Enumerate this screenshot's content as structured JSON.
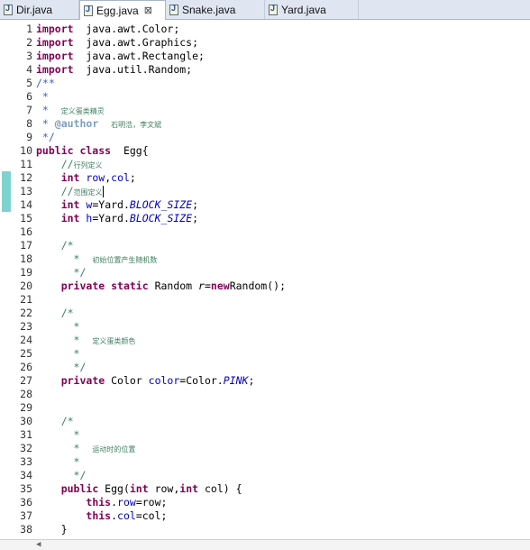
{
  "tabs": [
    {
      "label": "Dir.java",
      "active": false
    },
    {
      "label": "Egg.java",
      "active": true,
      "close": "⊠"
    },
    {
      "label": "Snake.java",
      "active": false
    },
    {
      "label": "Yard.java",
      "active": false
    }
  ],
  "editor": {
    "changed_lines": [
      12,
      13,
      14
    ],
    "lines": [
      {
        "n": "1",
        "t": [
          [
            "kw",
            "import"
          ],
          [
            "",
            "  java.awt.Color;"
          ]
        ]
      },
      {
        "n": "2",
        "t": [
          [
            "kw",
            "import"
          ],
          [
            "",
            "  java.awt.Graphics;"
          ]
        ]
      },
      {
        "n": "3",
        "t": [
          [
            "kw",
            "import"
          ],
          [
            "",
            "  java.awt.Rectangle;"
          ]
        ]
      },
      {
        "n": "4",
        "t": [
          [
            "kw",
            "import"
          ],
          [
            "",
            "  java.util.Random;"
          ]
        ]
      },
      {
        "n": "5",
        "t": [
          [
            "jd",
            "/**"
          ]
        ]
      },
      {
        "n": "6",
        "t": [
          [
            "jd",
            " *"
          ]
        ]
      },
      {
        "n": "7",
        "t": [
          [
            "jd",
            " *  "
          ],
          [
            "cjk",
            "定义蛋类精灵"
          ]
        ]
      },
      {
        "n": "8",
        "t": [
          [
            "jd",
            " * "
          ],
          [
            "tag",
            "@author"
          ],
          [
            "jd",
            "  "
          ],
          [
            "cjk",
            "石明浩，李文斌"
          ]
        ]
      },
      {
        "n": "9",
        "t": [
          [
            "jd",
            " */"
          ]
        ]
      },
      {
        "n": "10",
        "t": [
          [
            "kw",
            "public class"
          ],
          [
            "",
            "  Egg{"
          ]
        ]
      },
      {
        "n": "11",
        "t": [
          [
            "",
            "    "
          ],
          [
            "cm",
            "//"
          ],
          [
            "cjk",
            "行列定义"
          ]
        ]
      },
      {
        "n": "12",
        "t": [
          [
            "",
            "    "
          ],
          [
            "kw",
            "int"
          ],
          [
            "",
            " "
          ],
          [
            "fld",
            "row"
          ],
          [
            "",
            ","
          ],
          [
            "fld",
            "col"
          ],
          [
            "",
            ";"
          ]
        ]
      },
      {
        "n": "13",
        "t": [
          [
            "",
            "    "
          ],
          [
            "cm",
            "//"
          ],
          [
            "cjk",
            "范围定义"
          ],
          [
            "caret",
            ""
          ]
        ]
      },
      {
        "n": "14",
        "t": [
          [
            "",
            "    "
          ],
          [
            "kw",
            "int"
          ],
          [
            "",
            " "
          ],
          [
            "fld",
            "w"
          ],
          [
            "",
            "=Yard."
          ],
          [
            "st",
            "BLOCK_SIZE"
          ],
          [
            "",
            ";"
          ]
        ]
      },
      {
        "n": "15",
        "t": [
          [
            "",
            "    "
          ],
          [
            "kw",
            "int"
          ],
          [
            "",
            " "
          ],
          [
            "fld",
            "h"
          ],
          [
            "",
            "=Yard."
          ],
          [
            "st",
            "BLOCK_SIZE"
          ],
          [
            "",
            ";"
          ]
        ]
      },
      {
        "n": "16",
        "t": []
      },
      {
        "n": "17",
        "t": [
          [
            "",
            "    "
          ],
          [
            "cm",
            "/*"
          ]
        ]
      },
      {
        "n": "18",
        "t": [
          [
            "",
            "    "
          ],
          [
            "cm",
            "  *  "
          ],
          [
            "cjk",
            "初始位置产生随机数"
          ]
        ]
      },
      {
        "n": "19",
        "t": [
          [
            "",
            "    "
          ],
          [
            "cm",
            "  */"
          ]
        ]
      },
      {
        "n": "20",
        "t": [
          [
            "",
            "    "
          ],
          [
            "kw",
            "private static"
          ],
          [
            "",
            " Random "
          ],
          [
            "it",
            "r"
          ],
          [
            "",
            "="
          ],
          [
            "kw",
            "new"
          ],
          [
            "",
            "",
            " "
          ],
          [
            "",
            "Random();"
          ]
        ]
      },
      {
        "n": "21",
        "t": []
      },
      {
        "n": "22",
        "t": [
          [
            "",
            "    "
          ],
          [
            "cm",
            "/*"
          ]
        ]
      },
      {
        "n": "23",
        "t": [
          [
            "",
            "    "
          ],
          [
            "cm",
            "  *"
          ]
        ]
      },
      {
        "n": "24",
        "t": [
          [
            "",
            "    "
          ],
          [
            "cm",
            "  *  "
          ],
          [
            "cjk",
            "定义蛋类颜色"
          ]
        ]
      },
      {
        "n": "25",
        "t": [
          [
            "",
            "    "
          ],
          [
            "cm",
            "  *"
          ]
        ]
      },
      {
        "n": "26",
        "t": [
          [
            "",
            "    "
          ],
          [
            "cm",
            "  */"
          ]
        ]
      },
      {
        "n": "27",
        "t": [
          [
            "",
            "    "
          ],
          [
            "kw",
            "private"
          ],
          [
            "",
            " Color "
          ],
          [
            "fld",
            "color"
          ],
          [
            "",
            "=Color."
          ],
          [
            "st",
            "PINK"
          ],
          [
            "",
            ";"
          ]
        ]
      },
      {
        "n": "28",
        "t": []
      },
      {
        "n": "29",
        "t": []
      },
      {
        "n": "30",
        "t": [
          [
            "",
            "    "
          ],
          [
            "cm",
            "/*"
          ]
        ]
      },
      {
        "n": "31",
        "t": [
          [
            "",
            "    "
          ],
          [
            "cm",
            "  *"
          ]
        ]
      },
      {
        "n": "32",
        "t": [
          [
            "",
            "    "
          ],
          [
            "cm",
            "  *  "
          ],
          [
            "cjk",
            "运动时的位置"
          ]
        ]
      },
      {
        "n": "33",
        "t": [
          [
            "",
            "    "
          ],
          [
            "cm",
            "  *"
          ]
        ]
      },
      {
        "n": "34",
        "t": [
          [
            "",
            "    "
          ],
          [
            "cm",
            "  */"
          ]
        ]
      },
      {
        "n": "35",
        "t": [
          [
            "",
            "    "
          ],
          [
            "kw",
            "public"
          ],
          [
            "",
            " Egg("
          ],
          [
            "kw",
            "int"
          ],
          [
            "",
            " row,"
          ],
          [
            "kw",
            "int"
          ],
          [
            "",
            " col) {"
          ]
        ]
      },
      {
        "n": "36",
        "t": [
          [
            "",
            "        "
          ],
          [
            "kw",
            "this"
          ],
          [
            "",
            "."
          ],
          [
            "fld",
            "row"
          ],
          [
            "",
            "=row;"
          ]
        ]
      },
      {
        "n": "37",
        "t": [
          [
            "",
            "        "
          ],
          [
            "kw",
            "this"
          ],
          [
            "",
            "."
          ],
          [
            "fld",
            "col"
          ],
          [
            "",
            "=col;"
          ]
        ]
      },
      {
        "n": "38",
        "t": [
          [
            "",
            "    }"
          ]
        ]
      }
    ]
  },
  "scrollbar": {
    "left_arrow": "◀"
  }
}
